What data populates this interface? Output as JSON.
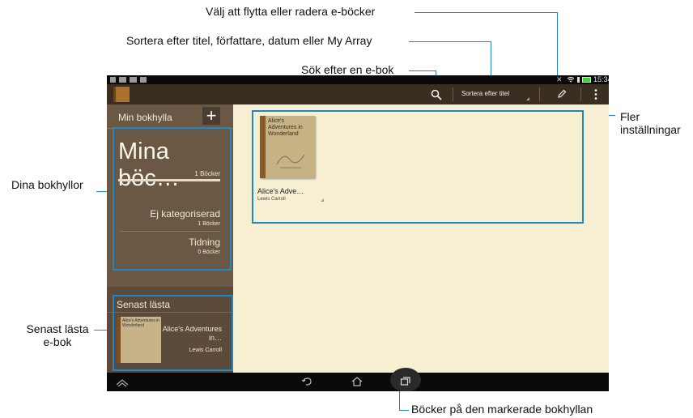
{
  "callouts": {
    "move_delete": "Välj att flytta eller radera e-böcker",
    "sort": "Sortera efter titel, författare, datum eller My Array",
    "search": "Sök efter en e-bok",
    "more": "Fler inställningar",
    "shelves": "Dina bokhyllor",
    "recent": "Senast lästa e-bok",
    "books": "Böcker på den markerade bokhyllan"
  },
  "status": {
    "time": "15:34"
  },
  "actionbar": {
    "sort_label": "Sortera efter titel"
  },
  "sidebar": {
    "title": "Min bokhylla",
    "main_shelf": {
      "name": "Mina böc…",
      "count": "1 Böcker"
    },
    "shelves": [
      {
        "name": "Ej kategoriserad",
        "count": "1 Böcker"
      },
      {
        "name": "Tidning",
        "count": "0 Böcker"
      }
    ],
    "recent_title": "Senast lästa",
    "recent_book": {
      "title": "Alice's Adventures in…",
      "author": "Lewis Carroll"
    }
  },
  "book": {
    "cover_title": "Alice's Adventures in Wonderland",
    "title": "Alice's Adve…",
    "author": "Lewis Carroll"
  },
  "colors": {
    "accent": "#1f86c8",
    "sidebar": "#6a5845",
    "content_bg": "#f7efd2"
  }
}
